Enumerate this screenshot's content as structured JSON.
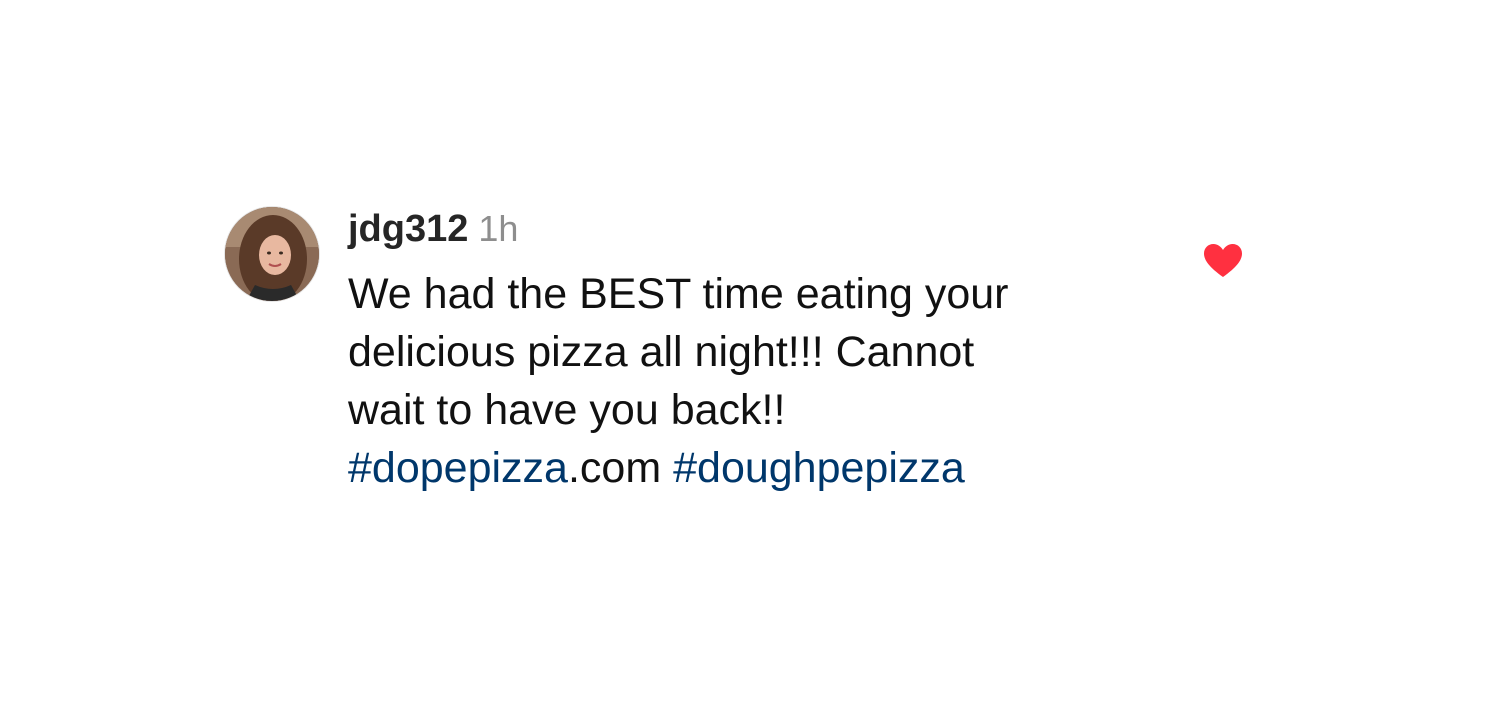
{
  "comment": {
    "username": "jdg312",
    "timestamp": "1h",
    "text_lines": [
      "We had the BEST time eating your",
      "delicious pizza all night!!! Cannot",
      "wait to have you back!!"
    ],
    "tag_line": {
      "hashtag_1": "#dopepizza",
      "suffix": ".com",
      "hashtag_2": "#doughpepizza"
    },
    "liked": true,
    "like_icon": "heart-icon",
    "colors": {
      "hashtag": "#00376b",
      "heart": "#ff3040",
      "username": "#262626",
      "timestamp": "#8e8e8e"
    }
  }
}
